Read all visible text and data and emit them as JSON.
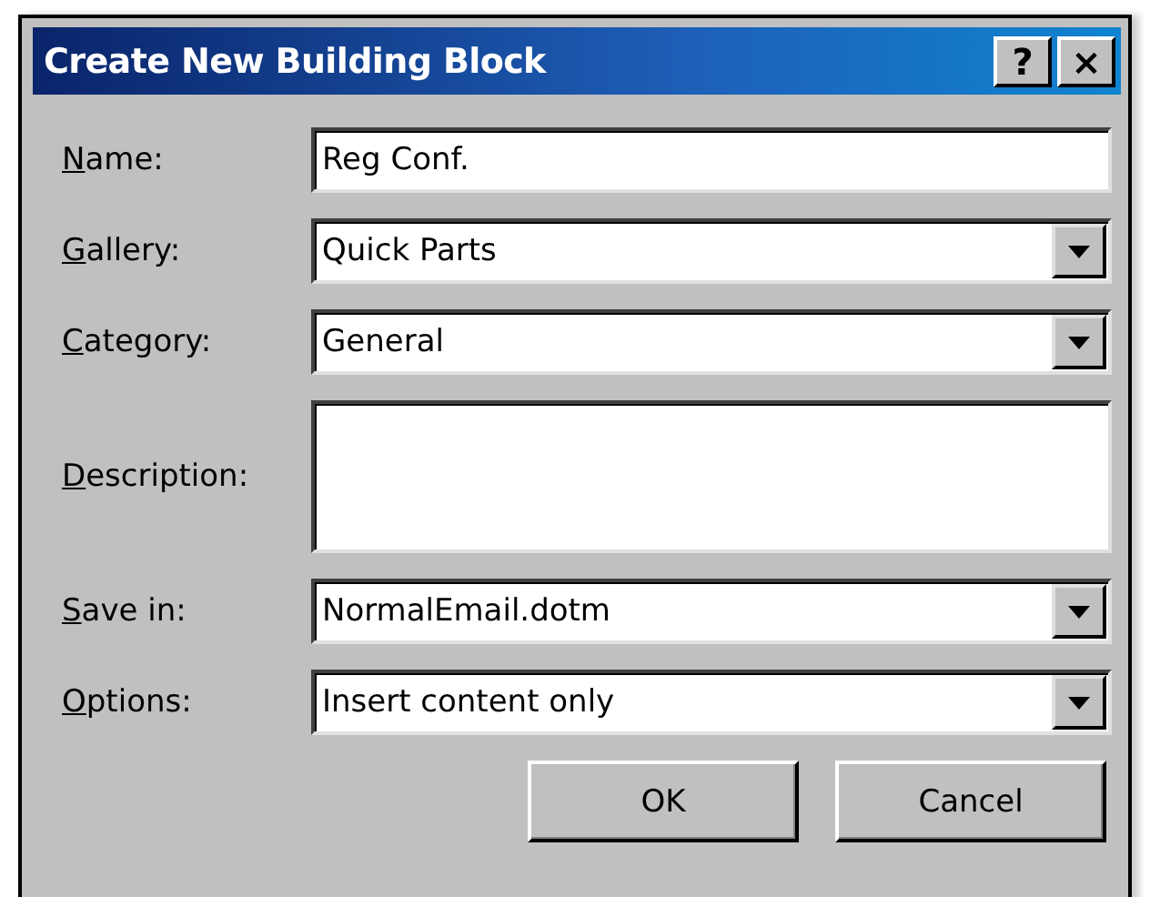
{
  "window": {
    "title": "Create New Building Block",
    "title_buttons": [
      "?",
      "×"
    ]
  },
  "fields": [
    {
      "label": "Name:",
      "kind": "text",
      "value": "Reg Conf."
    },
    {
      "label": "Gallery:",
      "kind": "combo",
      "value": "Quick Parts"
    },
    {
      "label": "Category:",
      "kind": "combo",
      "value": "General"
    },
    {
      "label": "Description:",
      "kind": "textarea"
    },
    {
      "label": "Save in:",
      "kind": "combo",
      "value": "NormalEmail.dotm"
    },
    {
      "label": "Options:",
      "kind": "combo",
      "value": "Insert content only"
    }
  ],
  "buttons": [
    "OK",
    "Cancel"
  ]
}
